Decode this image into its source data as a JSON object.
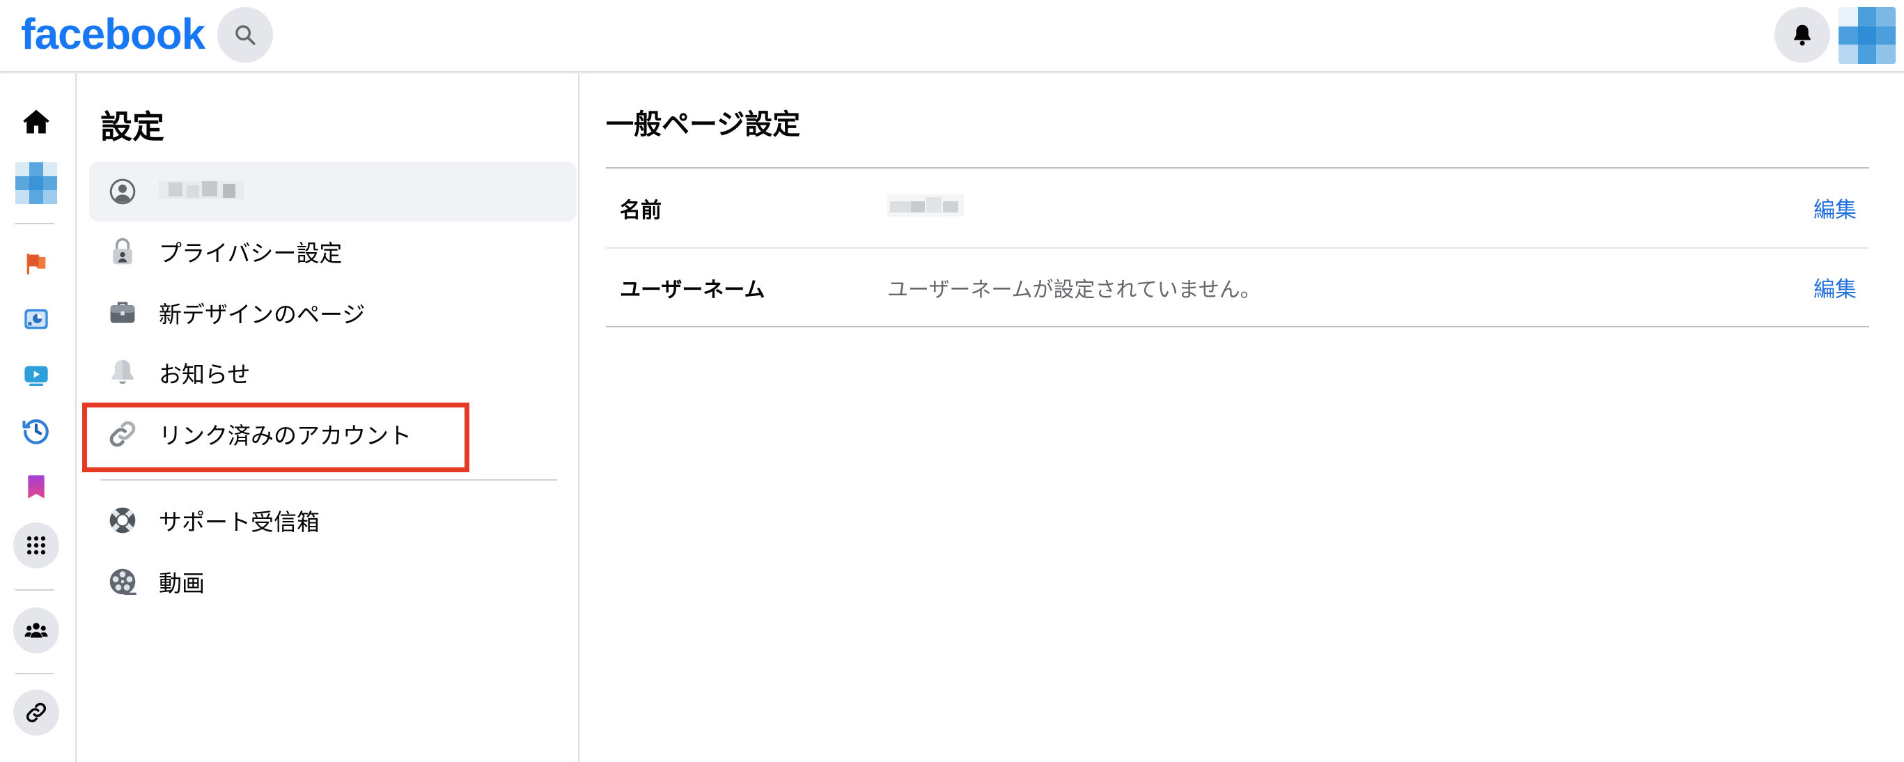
{
  "header": {
    "logo_text": "facebook",
    "brand_color": "#1877f2",
    "search_icon": "search-icon",
    "bell_icon": "bell-icon"
  },
  "rail": {
    "items": [
      "home-icon",
      "page-avatar",
      "flag-icon",
      "dashboard-icon",
      "video-icon",
      "clock-icon",
      "bookmark-icon",
      "apps-grid-icon",
      "groups-icon",
      "link-icon"
    ]
  },
  "settings": {
    "title": "設定",
    "items": [
      {
        "label": "",
        "icon": "profile-icon"
      },
      {
        "label": "プライバシー設定",
        "icon": "lock-icon"
      },
      {
        "label": "新デザインのページ",
        "icon": "briefcase-icon"
      },
      {
        "label": "お知らせ",
        "icon": "bell-icon"
      },
      {
        "label": "リンク済みのアカウント",
        "icon": "link-icon"
      },
      {
        "label": "サポート受信箱",
        "icon": "lifebuoy-icon"
      },
      {
        "label": "動画",
        "icon": "film-reel-icon"
      }
    ],
    "highlight_color": "#e53a24"
  },
  "main": {
    "title": "一般ページ設定",
    "rows": [
      {
        "label": "名前",
        "value": "",
        "edit": "編集"
      },
      {
        "label": "ユーザーネーム",
        "value": "ユーザーネームが設定されていません。",
        "edit": "編集"
      }
    ]
  }
}
